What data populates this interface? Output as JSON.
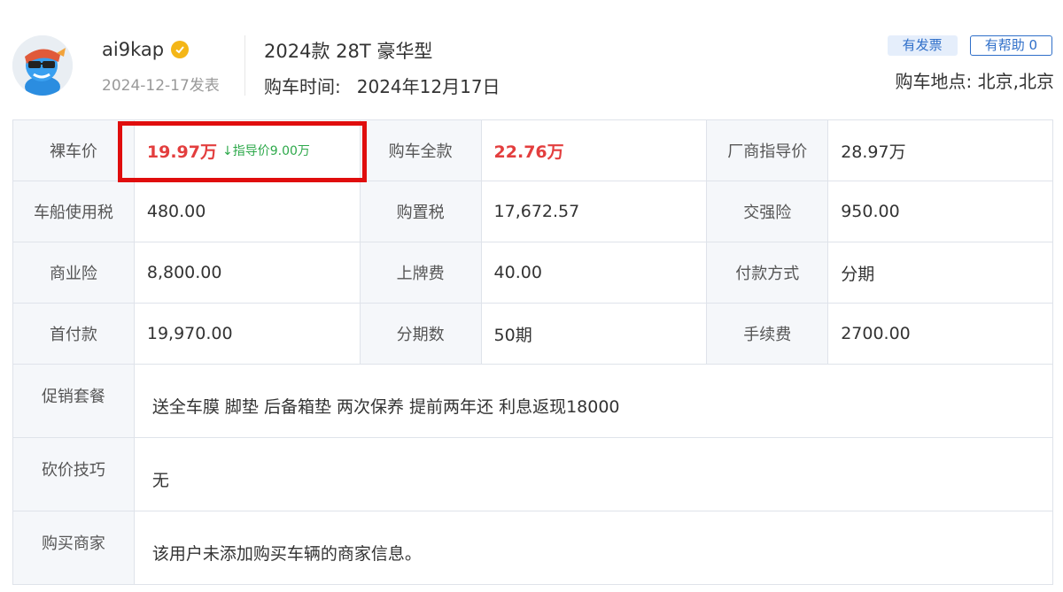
{
  "header": {
    "username": "ai9kap",
    "post_date": "2024-12-17发表",
    "model": "2024款 28T 豪华型",
    "buy_time_label": "购车时间:",
    "buy_time_value": "2024年12月17日",
    "tag_invoice": "有发票",
    "tag_helpful": "有帮助 0",
    "buy_place": "购车地点: 北京,北京"
  },
  "price_table": {
    "row1": {
      "l1": "裸车价",
      "v1_main": "19.97万",
      "v1_guide": "↓指导价9.00万",
      "l2": "购车全款",
      "v2": "22.76万",
      "l3": "厂商指导价",
      "v3": "28.97万"
    },
    "row2": {
      "l1": "车船使用税",
      "v1": "480.00",
      "l2": "购置税",
      "v2": "17,672.57",
      "l3": "交强险",
      "v3": "950.00"
    },
    "row3": {
      "l1": "商业险",
      "v1": "8,800.00",
      "l2": "上牌费",
      "v2": "40.00",
      "l3": "付款方式",
      "v3": "分期"
    },
    "row4": {
      "l1": "首付款",
      "v1": "19,970.00",
      "l2": "分期数",
      "v2": "50期",
      "l3": "手续费",
      "v3": "2700.00"
    },
    "promo": {
      "label": "促销套餐",
      "value": "送全车膜 脚垫 后备箱垫 两次保养 提前两年还 利息返现18000"
    },
    "bargain": {
      "label": "砍价技巧",
      "value": "无"
    },
    "dealer": {
      "label": "购买商家",
      "value": "该用户未添加购买车辆的商家信息。"
    }
  },
  "colors": {
    "accent_blue": "#2f6fc9",
    "price_red": "#e33e3e",
    "guide_green": "#2ea94b",
    "highlight_red": "#e00d0d",
    "verified_gold": "#f4b617"
  }
}
